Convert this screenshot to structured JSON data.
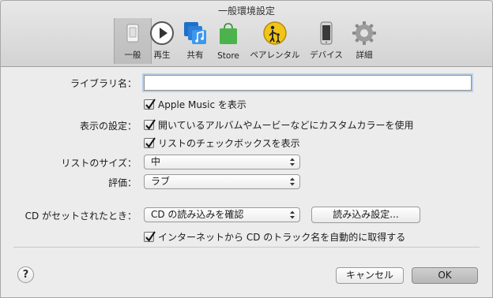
{
  "window": {
    "title": "一般環境設定"
  },
  "toolbar": {
    "items": [
      {
        "label": "一般",
        "icon": "general-switch-icon",
        "selected": true
      },
      {
        "label": "再生",
        "icon": "play-icon"
      },
      {
        "label": "共有",
        "icon": "music-share-icon"
      },
      {
        "label": "Store",
        "icon": "store-bag-icon"
      },
      {
        "label": "ペアレンタル",
        "icon": "parental-icon"
      },
      {
        "label": "デバイス",
        "icon": "iphone-icon"
      },
      {
        "label": "詳細",
        "icon": "gear-icon"
      }
    ]
  },
  "form": {
    "library_name": {
      "label": "ライブラリ名：",
      "value": ""
    },
    "apple_music": {
      "label": "Apple Music を表示",
      "checked": true
    },
    "display": {
      "label": "表示の設定：",
      "custom_colors": {
        "label": "開いているアルバムやムービーなどにカスタムカラーを使用",
        "checked": true
      },
      "list_checkboxes": {
        "label": "リストのチェックボックスを表示",
        "checked": true
      }
    },
    "list_size": {
      "label": "リストのサイズ：",
      "value": "中"
    },
    "rating": {
      "label": "評価：",
      "value": "ラブ"
    },
    "cd": {
      "label": "CD がセットされたとき：",
      "value": "CD の読み込みを確認",
      "import_settings_button": "読み込み設定...",
      "track_names": {
        "label": "インターネットから CD のトラック名を自動的に取得する",
        "checked": true
      }
    }
  },
  "footer": {
    "help": "?",
    "cancel": "キャンセル",
    "ok": "OK"
  },
  "colors": {
    "accent_focus": "#b9cfe8",
    "toolbar_blue": "#2c7fd8",
    "store_green": "#4bb34b",
    "parental_yellow": "#f0c419"
  }
}
